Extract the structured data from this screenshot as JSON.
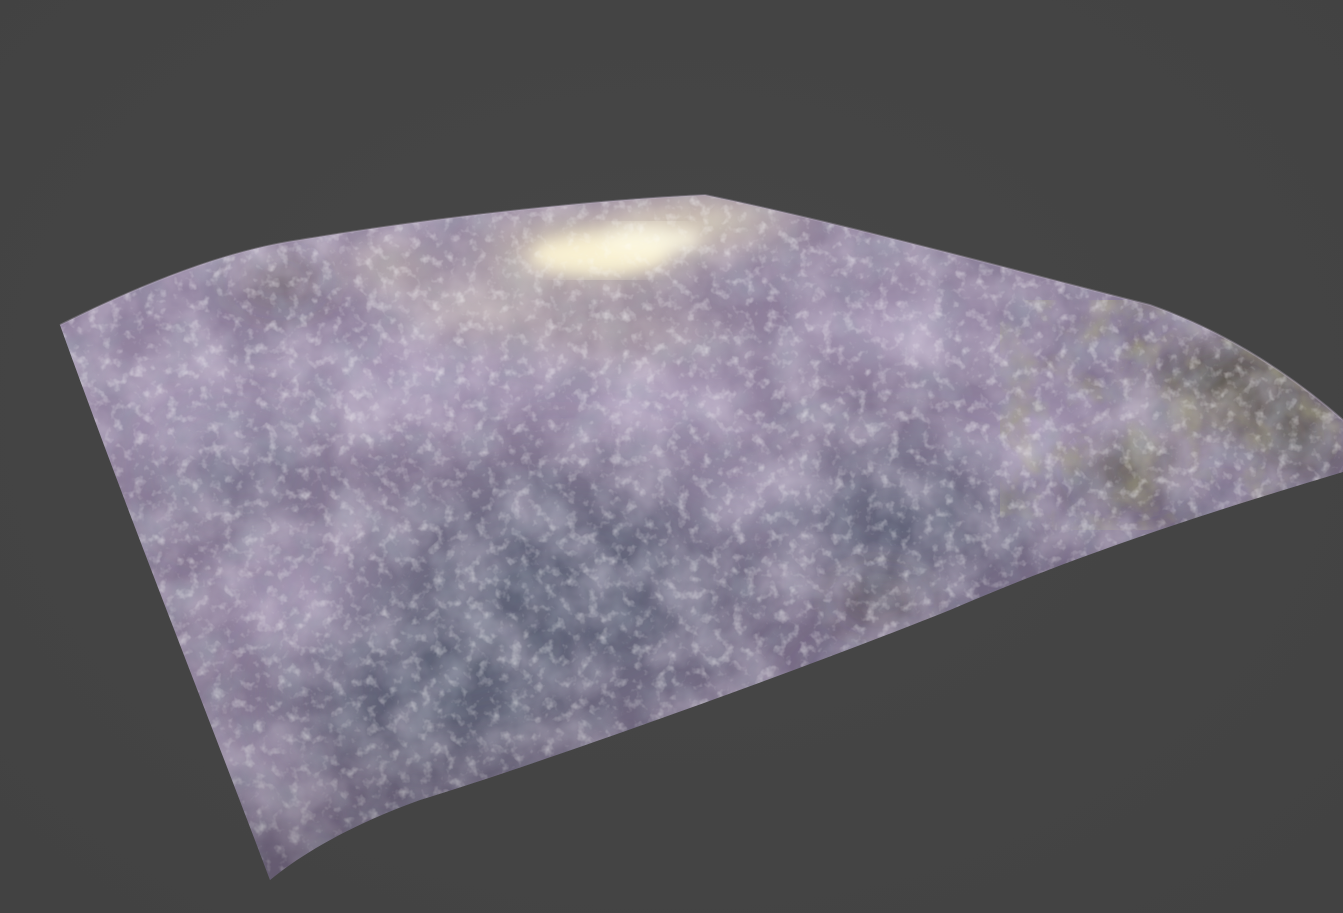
{
  "viewport": {
    "background_color": "#444444"
  },
  "plane": {
    "material_colors": {
      "base": "#8a7d98",
      "lavender": "#a898b8",
      "light": "#cdbfd6",
      "wet_blue": "#5f6b7e",
      "moss": "#5c5a3a",
      "highlight": "#fff3c8"
    },
    "surface": "wet-rock-moss"
  }
}
